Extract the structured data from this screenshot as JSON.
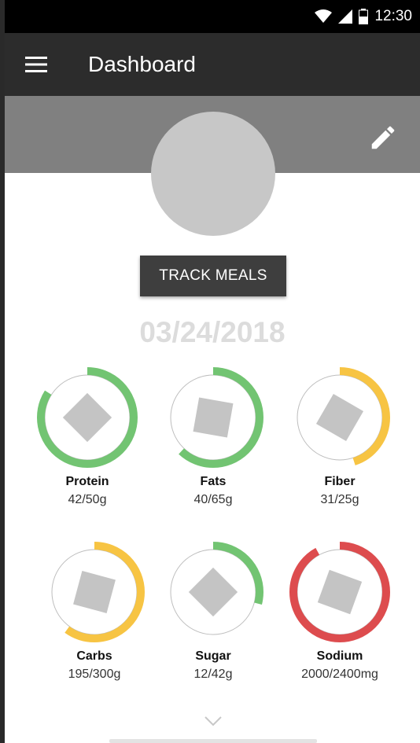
{
  "status_bar": {
    "time": "12:30",
    "icons": [
      "wifi-icon",
      "cell-signal-icon",
      "battery-icon"
    ]
  },
  "app_bar": {
    "title": "Dashboard",
    "menu_icon": "hamburger-menu-icon"
  },
  "header": {
    "edit_icon": "pencil-icon",
    "band_color": "#808080"
  },
  "track_button": {
    "label": "TRACK MEALS"
  },
  "date": "03/24/2018",
  "colors": {
    "green": "#72c472",
    "yellow": "#f7c443",
    "red": "#dd4c4e",
    "ring_outline": "#bdbdbd",
    "placeholder": "#c4c4c4"
  },
  "nutrients": [
    {
      "name": "Protein",
      "value": "42/50g",
      "progress": 0.84,
      "color": "green"
    },
    {
      "name": "Fats",
      "value": "40/65g",
      "progress": 0.62,
      "color": "green"
    },
    {
      "name": "Fiber",
      "value": "31/25g",
      "progress": 0.45,
      "color": "yellow"
    },
    {
      "name": "Carbs",
      "value": "195/300g",
      "progress": 0.6,
      "color": "yellow"
    },
    {
      "name": "Sugar",
      "value": "12/42g",
      "progress": 0.29,
      "color": "green"
    },
    {
      "name": "Sodium",
      "value": "2000/2400mg",
      "progress": 0.92,
      "color": "red"
    }
  ],
  "footer": {
    "expand_icon": "chevron-down-icon"
  }
}
